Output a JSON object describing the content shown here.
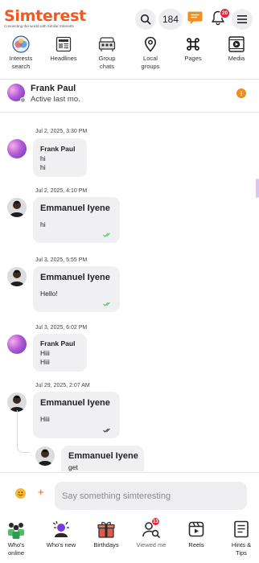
{
  "app": {
    "logo": "Simterest",
    "tagline": "Connecting the world with Similar Interests",
    "brand_color": "#f05a22"
  },
  "header": {
    "search_icon": "search-icon",
    "points": "184",
    "chat_icon": "chat-icon",
    "notifications_icon": "bell-icon",
    "notifications_count": "20",
    "menu_icon": "hamburger-menu-icon"
  },
  "nav": {
    "items": [
      {
        "label_1": "Interests",
        "label_2": "search",
        "icon": "interests-search-icon"
      },
      {
        "label_1": "Headlines",
        "label_2": "",
        "icon": "newspaper-icon"
      },
      {
        "label_1": "Group",
        "label_2": "chats",
        "icon": "group-chats-icon"
      },
      {
        "label_1": "Local",
        "label_2": "groups",
        "icon": "location-pin-icon"
      },
      {
        "label_1": "Pages",
        "label_2": "",
        "icon": "command-icon"
      },
      {
        "label_1": "Media",
        "label_2": "",
        "icon": "media-play-icon"
      }
    ]
  },
  "conversation": {
    "name": "Frank Paul",
    "status": "Active last mo.",
    "info_icon": "i"
  },
  "messages": [
    {
      "timestamp": "Jul 2, 2025, 3:30 PM",
      "sender": "Frank Paul",
      "lines": [
        "hi",
        "hi"
      ]
    },
    {
      "timestamp": "Jul 2, 2025, 4:10 PM",
      "sender": "Emmanuel Iyene",
      "lines": [
        "hi"
      ],
      "read": true
    },
    {
      "timestamp": "Jul 3, 2025, 5:55 PM",
      "sender": "Emmanuel Iyene",
      "lines": [
        "Hello!"
      ],
      "read": true
    },
    {
      "timestamp": "Jul 3, 2025, 6:02 PM",
      "sender": "Frank Paul",
      "lines": [
        "Hiii",
        "Hiii"
      ]
    },
    {
      "timestamp": "Jul 29, 2025, 2:07 AM",
      "sender": "Emmanuel Iyene",
      "lines": [
        "Hiii"
      ],
      "read": false
    },
    {
      "timestamp": "",
      "sender": "Emmanuel Iyene",
      "lines": [
        "get"
      ]
    }
  ],
  "composer": {
    "placeholder": "Say something simteresting",
    "plus": "+"
  },
  "bottom_nav": {
    "items": [
      {
        "label_1": "Who's",
        "label_2": "online",
        "icon": "whos-online-icon"
      },
      {
        "label_1": "Who's new",
        "label_2": "",
        "icon": "whos-new-icon"
      },
      {
        "label_1": "Birthdays",
        "label_2": "",
        "icon": "gift-icon"
      },
      {
        "label_1": "Viewed me",
        "label_2": "",
        "icon": "viewed-me-icon",
        "badge": "13"
      },
      {
        "label_1": "Reels",
        "label_2": "",
        "icon": "reels-icon"
      },
      {
        "label_1": "Hints &",
        "label_2": "Tips",
        "icon": "hints-tips-icon"
      }
    ]
  }
}
